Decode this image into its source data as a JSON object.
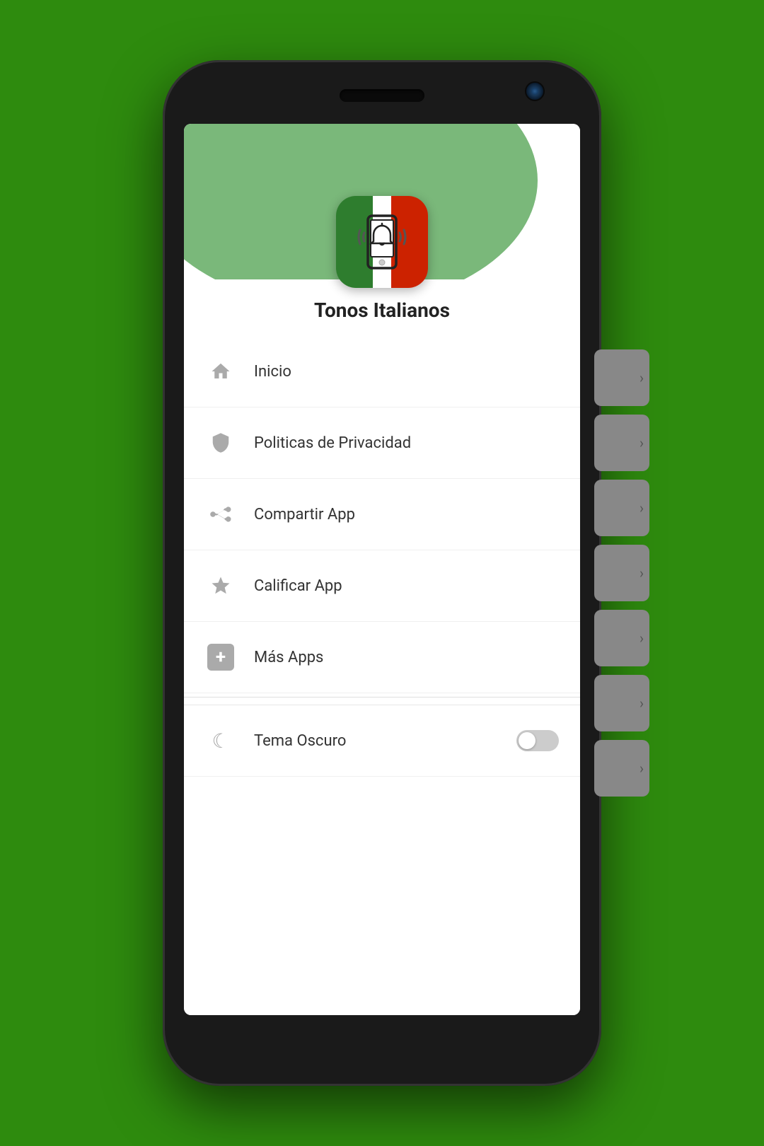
{
  "background_color": "#2e8b0e",
  "phone": {
    "screen": {
      "header": {
        "app_title": "Tonos Italianos",
        "wave_color": "#6aab6a"
      },
      "menu": {
        "items": [
          {
            "id": "inicio",
            "label": "Inicio",
            "icon": "home-icon"
          },
          {
            "id": "politicas",
            "label": "Politicas de Privacidad",
            "icon": "shield-icon"
          },
          {
            "id": "compartir",
            "label": "Compartir App",
            "icon": "share-icon"
          },
          {
            "id": "calificar",
            "label": "Calificar App",
            "icon": "star-icon"
          },
          {
            "id": "mas-apps",
            "label": "Más Apps",
            "icon": "plus-icon"
          }
        ],
        "dark_mode": {
          "label": "Tema Oscuro",
          "enabled": false,
          "icon": "moon-icon"
        }
      }
    },
    "side_cards": [
      {
        "chevron": "›"
      },
      {
        "chevron": "›"
      },
      {
        "chevron": "›"
      },
      {
        "chevron": "›"
      },
      {
        "chevron": "›"
      },
      {
        "chevron": "›"
      },
      {
        "chevron": "›"
      }
    ]
  }
}
